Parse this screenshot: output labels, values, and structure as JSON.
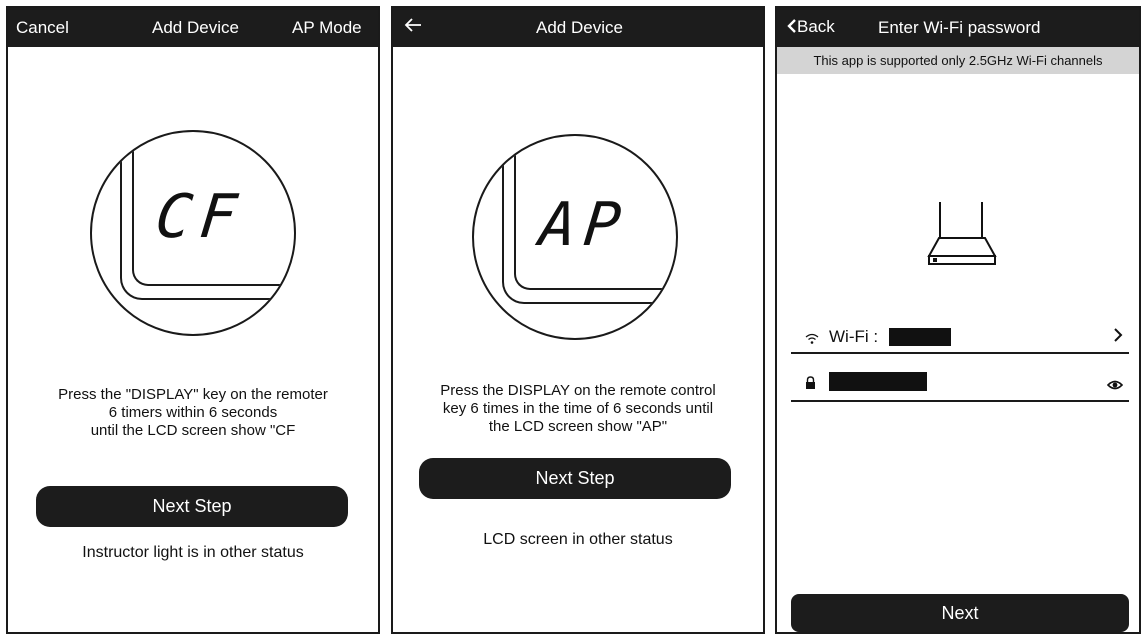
{
  "screen1": {
    "cancel": "Cancel",
    "title": "Add Device",
    "ap_mode": "AP Mode",
    "lcd_text": "CF",
    "instructions": [
      "Press the \"DISPLAY\" key on the remoter",
      "6 timers within 6 seconds",
      "until the LCD screen show \"CF"
    ],
    "next_step": "Next Step",
    "other_status": "Instructor light is in other status"
  },
  "screen2": {
    "back_icon": "arrow-left-icon",
    "title": "Add Device",
    "lcd_text": "AP",
    "instructions": [
      "Press the DISPLAY on the remote control",
      "key 6 times in the time of 6 seconds until",
      "the LCD screen show \"AP\""
    ],
    "next_step": "Next Step",
    "other_status": "LCD screen in other status"
  },
  "screen3": {
    "back": "Back",
    "title": "Enter Wi-Fi password",
    "notice": "This app is supported only 2.5GHz Wi-Fi channels",
    "wifi_label": "Wi-Fi :",
    "next": "Next"
  },
  "icons": {
    "wifi": "wifi-icon",
    "lock": "lock-icon",
    "eye": "eye-icon",
    "chevron": "chevron-right-icon",
    "router": "router-icon"
  }
}
